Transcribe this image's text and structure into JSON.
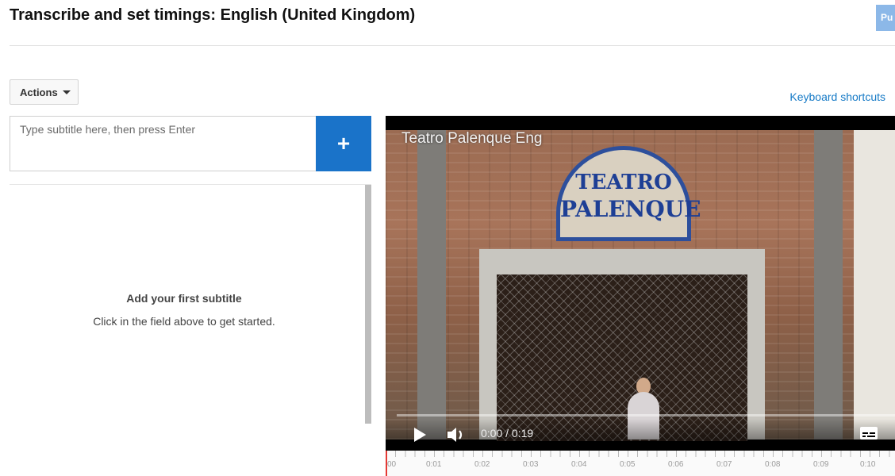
{
  "header": {
    "title": "Transcribe and set timings: English (United Kingdom)",
    "publish_label": "Pu"
  },
  "toolbar": {
    "actions_label": "Actions",
    "keyboard_shortcuts_label": "Keyboard shortcuts"
  },
  "editor": {
    "input_placeholder": "Type subtitle here, then press Enter",
    "add_label": "+"
  },
  "empty_state": {
    "title": "Add your first subtitle",
    "subtitle": "Click in the field above to get started."
  },
  "video": {
    "title": "Teatro Palenque Eng",
    "sign_line1": "TEATRO",
    "sign_line2": "PALENQUE",
    "time_display": "0:00 / 0:19",
    "progress": 0
  },
  "timeline": {
    "ticks": [
      "00",
      "0:01",
      "0:02",
      "0:03",
      "0:04",
      "0:05",
      "0:06",
      "0:07",
      "0:08",
      "0:09",
      "0:10"
    ]
  },
  "colors": {
    "accent": "#1a73c9",
    "link": "#167ac6",
    "playhead": "#e53935"
  }
}
